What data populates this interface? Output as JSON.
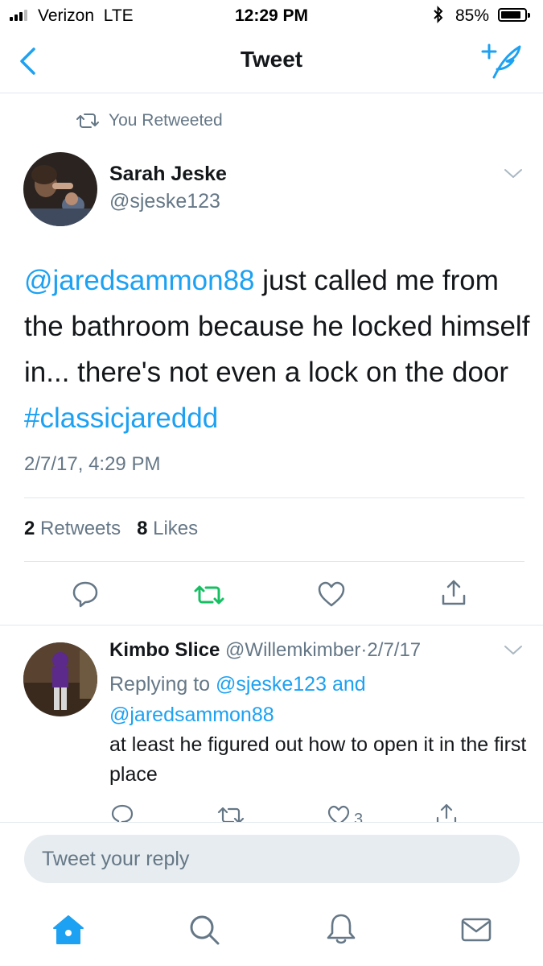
{
  "status_bar": {
    "carrier": "Verizon",
    "network": "LTE",
    "time": "12:29 PM",
    "battery_percent": "85%",
    "battery_level": 0.85
  },
  "nav": {
    "title": "Tweet"
  },
  "retweet_context": {
    "label": "You Retweeted"
  },
  "tweet": {
    "author_name": "Sarah Jeske",
    "author_handle": "@sjeske123",
    "mention": "@jaredsammon88",
    "text_body": " just called me from the bathroom because he locked himself in... there's not even a lock on the door ",
    "hashtag": "#classicjareddd",
    "timestamp": "2/7/17, 4:29 PM",
    "retweet_count": "2",
    "retweet_label": "Retweets",
    "like_count": "8",
    "like_label": "Likes"
  },
  "reply": {
    "author_name": "Kimbo Slice",
    "author_handle": "@Willemkimber",
    "separator": "·",
    "date": "2/7/17",
    "replying_prefix": "Replying to",
    "replying_user1": "@sjeske123",
    "replying_and": "and",
    "replying_user2": "@jaredsammon88",
    "text": "at least he figured out how to open it in the first place",
    "like_count": "3"
  },
  "composer": {
    "placeholder": "Tweet your reply"
  },
  "colors": {
    "accent": "#1da1f2",
    "retweet_green": "#17bf63",
    "secondary_text": "#657786",
    "divider": "#e1e8ed"
  },
  "icons": {
    "back": "chevron-left-icon",
    "compose": "compose-feather-icon",
    "home": "home-icon",
    "search": "search-icon",
    "notifications": "bell-icon",
    "messages": "envelope-icon"
  }
}
